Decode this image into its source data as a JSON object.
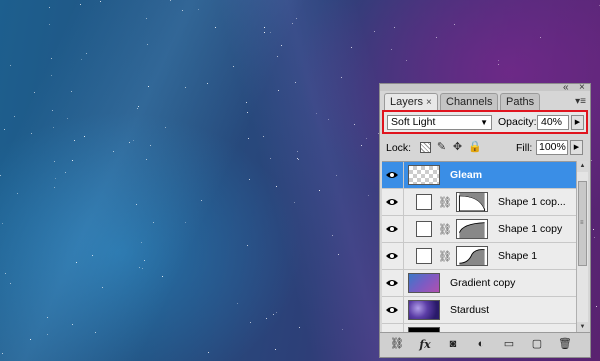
{
  "panel": {
    "tabs": [
      {
        "label": "Layers",
        "active": true,
        "close": "×"
      },
      {
        "label": "Channels",
        "active": false
      },
      {
        "label": "Paths",
        "active": false
      }
    ],
    "controls": {
      "minimize": "«",
      "close": "×",
      "menu": "▾≡"
    },
    "blend": {
      "mode": "Soft Light",
      "opacity_label": "Opacity:",
      "opacity_value": "40%"
    },
    "lock": {
      "label": "Lock:",
      "fill_label": "Fill:",
      "fill_value": "100%"
    },
    "layers": [
      {
        "name": "Gleam",
        "thumb": "checker",
        "selected": true,
        "visible": true
      },
      {
        "name": "Shape 1 cop...",
        "thumb": "shape",
        "has_mask": true,
        "visible": true
      },
      {
        "name": "Shape 1 copy",
        "thumb": "shape",
        "has_mask": true,
        "visible": true
      },
      {
        "name": "Shape 1",
        "thumb": "shape",
        "has_mask": true,
        "visible": true
      },
      {
        "name": "Gradient copy",
        "thumb": "grad",
        "visible": true
      },
      {
        "name": "Stardust",
        "thumb": "stardust",
        "visible": true
      },
      {
        "name": "",
        "thumb": "black",
        "visible": true
      }
    ],
    "footer_icons": [
      "link-layers-icon",
      "fx-icon",
      "add-mask-icon",
      "adjustment-layer-icon",
      "new-group-icon",
      "new-layer-icon",
      "trash-icon"
    ],
    "footer_glyphs": {
      "fx": "fx"
    }
  },
  "colors": {
    "selection": "#3a8ee6",
    "highlight_box": "#e0141e"
  }
}
